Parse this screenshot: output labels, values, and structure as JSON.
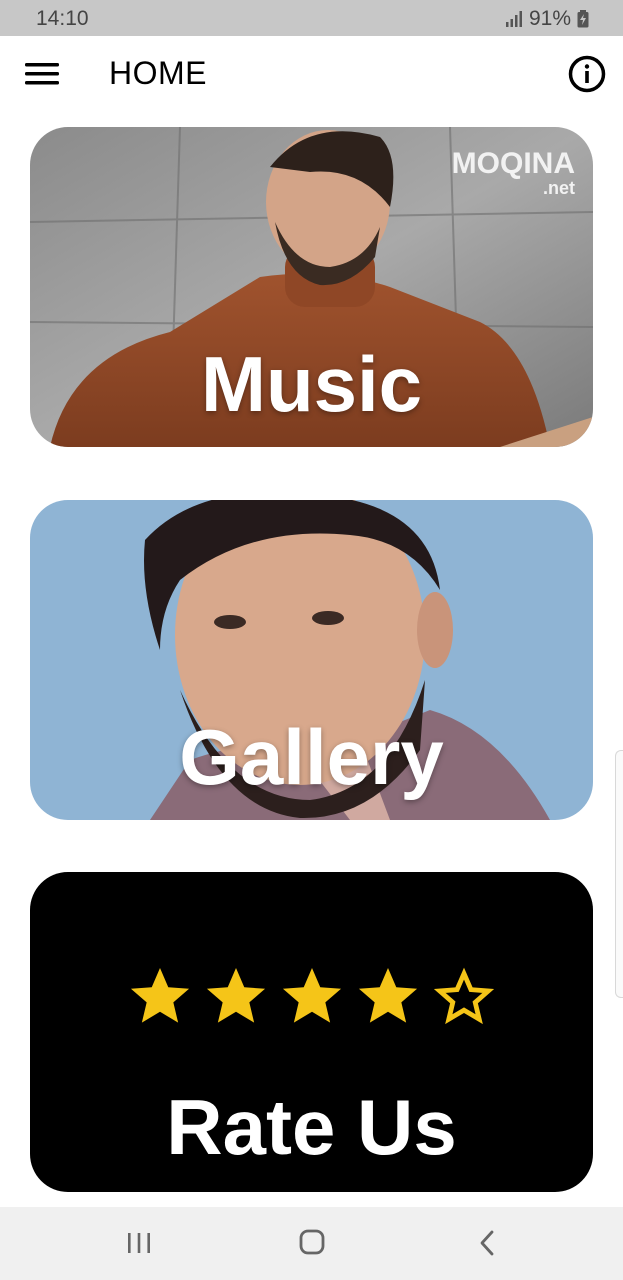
{
  "status_bar": {
    "time": "14:10",
    "battery_percent": "91%",
    "icons": [
      "signal-icon",
      "battery-charging-icon"
    ]
  },
  "app_bar": {
    "title": "HOME",
    "icons": [
      "menu-icon",
      "info-icon"
    ]
  },
  "cards": {
    "music": {
      "label": "Music",
      "watermark": "MOQINA",
      "watermark_sub": ".net"
    },
    "gallery": {
      "label": "Gallery"
    },
    "rate": {
      "label": "Rate Us",
      "stars_filled": 4,
      "stars_total": 5
    }
  },
  "colors": {
    "status_bar": "#c7c7c7",
    "star": "#f5c518",
    "rate_card_bg": "#000000",
    "nav_bar": "#f0f0f0"
  },
  "nav_bar": {
    "icons": [
      "recents-icon",
      "home-icon",
      "back-icon"
    ]
  }
}
